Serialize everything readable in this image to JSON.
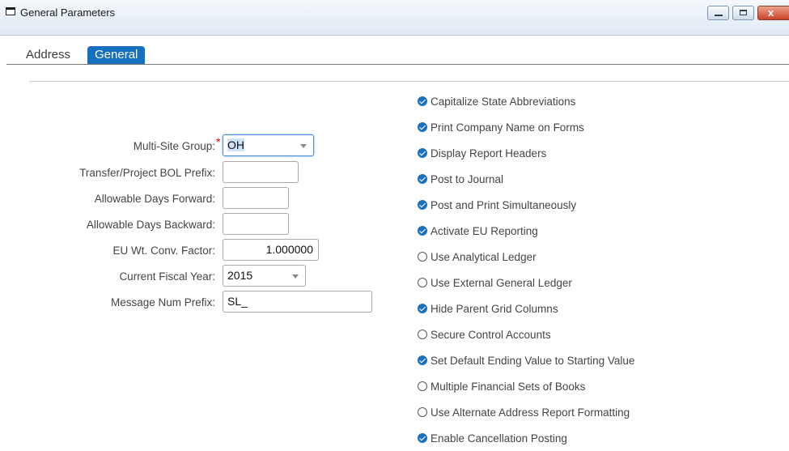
{
  "window": {
    "title": "General Parameters",
    "icon": "window-icon",
    "buttons": {
      "minimize": "minimize-icon",
      "maximize": "maximize-icon",
      "close": "x"
    }
  },
  "tabs": [
    {
      "label": "Address",
      "active": false
    },
    {
      "label": "General",
      "active": true
    }
  ],
  "form": {
    "multi_site_group": {
      "label": "Multi-Site Group:",
      "value": "OH",
      "required": "*"
    },
    "bol_prefix": {
      "label": "Transfer/Project BOL Prefix:",
      "value": ""
    },
    "days_forward": {
      "label": "Allowable Days Forward:",
      "value": ""
    },
    "days_backward": {
      "label": "Allowable Days Backward:",
      "value": ""
    },
    "eu_factor": {
      "label": "EU Wt. Conv. Factor:",
      "value": "1.000000"
    },
    "fiscal_year": {
      "label": "Current Fiscal Year:",
      "value": "2015"
    },
    "msg_prefix": {
      "label": "Message Num Prefix:",
      "value": "SL_"
    }
  },
  "checkboxes": [
    {
      "label": "Capitalize State Abbreviations",
      "checked": true
    },
    {
      "label": "Print Company Name on Forms",
      "checked": true
    },
    {
      "label": "Display Report Headers",
      "checked": true
    },
    {
      "label": "Post to Journal",
      "checked": true
    },
    {
      "label": "Post and Print Simultaneously",
      "checked": true
    },
    {
      "label": "Activate EU Reporting",
      "checked": true
    },
    {
      "label": "Use Analytical Ledger",
      "checked": false
    },
    {
      "label": "Use External General Ledger",
      "checked": false
    },
    {
      "label": "Hide Parent Grid Columns",
      "checked": true
    },
    {
      "label": "Secure Control Accounts",
      "checked": false
    },
    {
      "label": "Set Default Ending Value to Starting Value",
      "checked": true
    },
    {
      "label": "Multiple Financial Sets of Books",
      "checked": false
    },
    {
      "label": "Use Alternate Address Report Formatting",
      "checked": false
    },
    {
      "label": "Enable Cancellation Posting",
      "checked": true
    }
  ],
  "colors": {
    "accent": "#1570c0",
    "required": "#dd0000",
    "close": "#c9432a"
  }
}
